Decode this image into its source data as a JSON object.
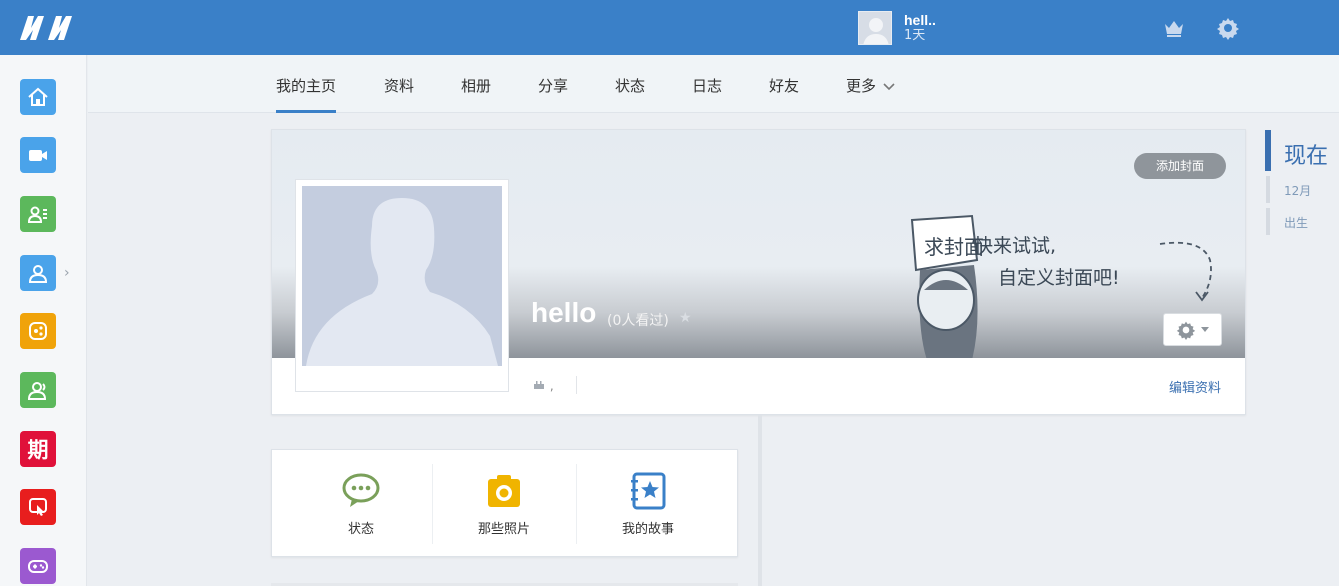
{
  "header": {
    "user_name": "hell..",
    "user_sub": "1天",
    "icons": [
      "logo-icon",
      "crown-icon",
      "gear-icon"
    ]
  },
  "sidebar": {
    "items": [
      {
        "icon": "home-icon",
        "color": "#4aa3ea"
      },
      {
        "icon": "video-icon",
        "color": "#4aa3ea"
      },
      {
        "icon": "contact-card-icon",
        "color": "#5cb85c"
      },
      {
        "icon": "person-icon",
        "color": "#4aa3ea"
      },
      {
        "icon": "share-icon",
        "color": "#f0a30a"
      },
      {
        "icon": "friends-icon",
        "color": "#5cb85c"
      },
      {
        "icon": "qi-badge-icon",
        "color": "#e0113a",
        "glyph": "期"
      },
      {
        "icon": "hand-click-icon",
        "color": "#e81e1e"
      },
      {
        "icon": "gamepad-icon",
        "color": "#9b59d0"
      }
    ]
  },
  "subnav": {
    "tabs": [
      "我的主页",
      "资料",
      "相册",
      "分享",
      "状态",
      "日志",
      "好友",
      "更多"
    ],
    "active": "我的主页"
  },
  "cover": {
    "add_cover": "添加封面",
    "name": "hello",
    "views": "(0人看过)",
    "info": ",",
    "edit_profile": "编辑资料",
    "art_sign": "求封面",
    "art_line1": "快来试试,",
    "art_line2": "自定义封面吧!"
  },
  "actions": [
    {
      "label": "状态",
      "icon": "chat-bubble-icon",
      "color": "#7aa05a"
    },
    {
      "label": "那些照片",
      "icon": "camera-icon",
      "color": "#f0b400"
    },
    {
      "label": "我的故事",
      "icon": "story-book-icon",
      "color": "#3a80c8"
    }
  ],
  "timeline": {
    "now": "现在",
    "items": [
      "12月",
      "出生"
    ]
  }
}
